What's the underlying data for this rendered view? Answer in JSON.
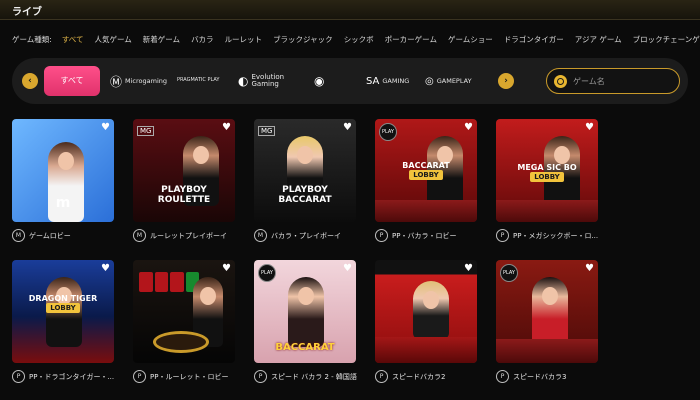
{
  "header": {
    "title": "ライブ"
  },
  "game_types": {
    "label": "ゲーム種類:",
    "items": [
      "すべて",
      "人気ゲーム",
      "新着ゲーム",
      "バカラ",
      "ルーレット",
      "ブラックジャック",
      "シックボ",
      "ポーカーゲーム",
      "ゲームショー",
      "ドラゴンタイガー",
      "アジア ゲーム",
      "ブロックチェーンゲーム"
    ],
    "active_index": 0
  },
  "providers": {
    "all_label": "すべて",
    "items": [
      {
        "mark": "Ⓜ",
        "label": "Microgaming"
      },
      {
        "mark": "",
        "label": "PRAGMATIC PLAY"
      },
      {
        "mark": "◐",
        "label": "Evolution Gaming"
      },
      {
        "mark": "◉",
        "label": ""
      },
      {
        "mark": "SA",
        "label": "GAMING"
      },
      {
        "mark": "◎",
        "label": "GAMEPLAY"
      }
    ],
    "prev_icon": "chevron-left",
    "next_icon": "chevron-right"
  },
  "search": {
    "placeholder": "ゲーム名"
  },
  "games": [
    {
      "name": "ゲームロビー",
      "provider_badge": "M",
      "theme": "blue",
      "banner": "",
      "lobby": ""
    },
    {
      "name": "ルーレットプレイボーイ",
      "provider_badge": "M",
      "theme": "red-dark",
      "banner": "PLAYBOY ROULETTE",
      "lobby": ""
    },
    {
      "name": "バカラ・プレイボーイ",
      "provider_badge": "M",
      "theme": "dark",
      "banner": "PLAYBOY BACCARAT",
      "lobby": ""
    },
    {
      "name": "PP・バカラ・ロビー",
      "provider_badge": "P",
      "theme": "red",
      "banner": "BACCARAT",
      "lobby": "LOBBY"
    },
    {
      "name": "PP・メガシックボー・ロ...",
      "provider_badge": "P",
      "theme": "red",
      "banner": "MEGA SIC BO",
      "lobby": "LOBBY"
    },
    {
      "name": "PP・ドラゴンタイガー・...",
      "provider_badge": "P",
      "theme": "red-blue",
      "banner": "DRAGON TIGER",
      "lobby": "LOBBY"
    },
    {
      "name": "PP・ルーレット・ロビー",
      "provider_badge": "P",
      "theme": "black",
      "banner": "",
      "lobby": ""
    },
    {
      "name": "スピード バカラ 2 - 韓国語",
      "provider_badge": "P",
      "theme": "pink",
      "banner": "BACCARAT",
      "lobby": ""
    },
    {
      "name": "スピードバカラ2",
      "provider_badge": "P",
      "theme": "red-studio",
      "banner": "",
      "lobby": ""
    },
    {
      "name": "スピードバカラ3",
      "provider_badge": "P",
      "theme": "red-studio",
      "banner": "",
      "lobby": ""
    }
  ],
  "colors": {
    "accent": "#e5b94a",
    "pink": "#ff4f8a",
    "bg": "#0b0b0b"
  }
}
